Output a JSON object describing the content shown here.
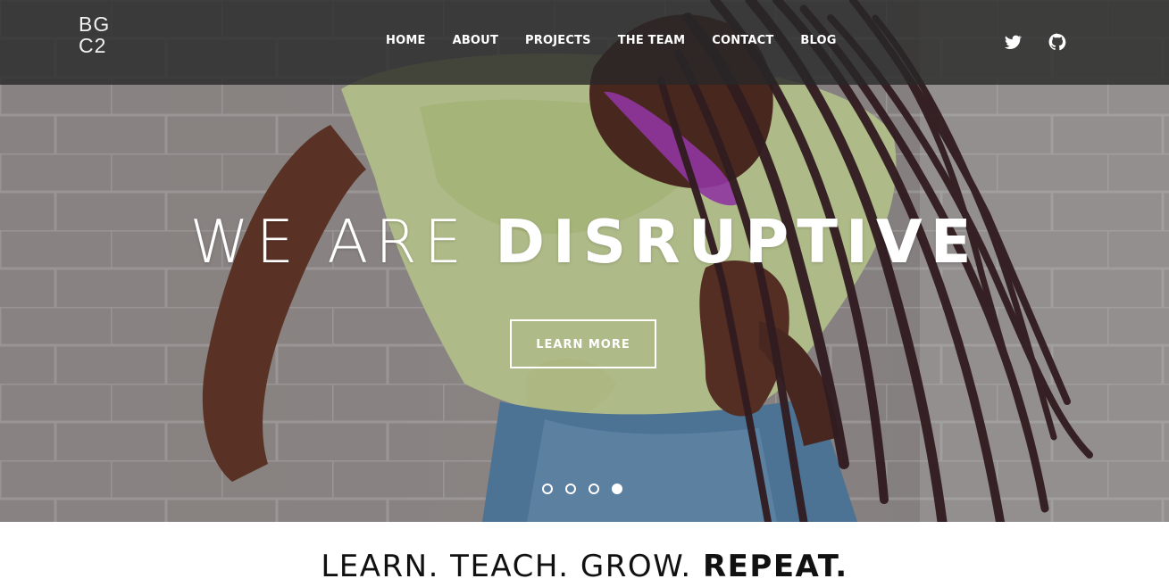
{
  "brand": {
    "logo_line1": "BG",
    "logo_line2": "C2"
  },
  "nav": {
    "links": [
      {
        "label": "HOME"
      },
      {
        "label": "ABOUT"
      },
      {
        "label": "PROJECTS"
      },
      {
        "label": "THE TEAM"
      },
      {
        "label": "CONTACT"
      },
      {
        "label": "BLOG"
      }
    ],
    "social": [
      {
        "icon": "twitter-icon"
      },
      {
        "icon": "github-icon"
      }
    ]
  },
  "hero": {
    "headline_light": "WE ARE",
    "headline_bold": "DISRUPTIVE",
    "cta_label": "LEARN MORE",
    "slides_total": 4,
    "active_slide": 4
  },
  "tagline": {
    "text": "LEARN. TEACH. GROW.",
    "emphasis": "REPEAT."
  },
  "colors": {
    "navbar": "#282828",
    "text_light": "#ffffff",
    "text_dark": "#111111"
  }
}
